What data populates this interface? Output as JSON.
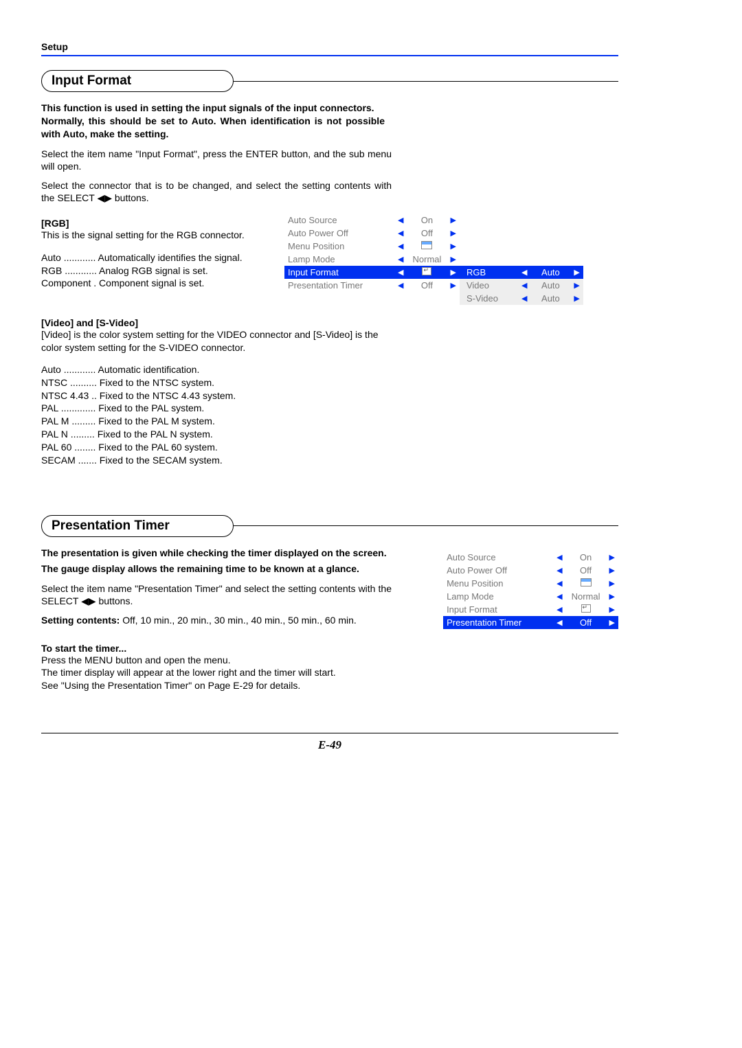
{
  "header": "Setup",
  "s1": {
    "title": "Input Format",
    "intro": "This function is used in setting the input signals of the input connectors.\nNormally, this should be set to Auto. When identification is not possible with Auto, make the setting.",
    "body1": "Select the item name \"Input Format\", press the ENTER button, and the sub menu will open.",
    "body2": "Select the connector that is to be changed, and select the setting contents with the SELECT ◀▶ buttons.",
    "rgb": {
      "head": "[RGB]",
      "desc": "This is the signal setting for the RGB connector.",
      "items": [
        {
          "k": "Auto",
          "dots": "............",
          "v": "Automatically identifies the signal."
        },
        {
          "k": "RGB",
          "dots": "............",
          "v": "Analog RGB signal is set."
        },
        {
          "k": "Component",
          "dots": " .",
          "v": "Component signal is set."
        }
      ]
    },
    "video": {
      "head": "[Video] and [S-Video]",
      "desc": "[Video] is the color system setting for the VIDEO connector and [S-Video] is the color system setting for the S-VIDEO connector.",
      "items": [
        {
          "k": "Auto",
          "dots": "............",
          "v": "Automatic identification."
        },
        {
          "k": "NTSC",
          "dots": "..........",
          "v": "Fixed to the NTSC system."
        },
        {
          "k": "NTSC 4.43",
          "dots": " ..",
          "v": "Fixed to the NTSC 4.43 system."
        },
        {
          "k": "PAL",
          "dots": ".............",
          "v": "Fixed to the PAL system."
        },
        {
          "k": "PAL M",
          "dots": ".........",
          "v": "Fixed to the PAL M system."
        },
        {
          "k": "PAL N",
          "dots": ".........",
          "v": "Fixed to the PAL N system."
        },
        {
          "k": "PAL 60",
          "dots": "........",
          "v": "Fixed to the PAL 60 system."
        },
        {
          "k": "SECAM",
          "dots": ".......",
          "v": "Fixed to the SECAM system."
        }
      ]
    },
    "osd": {
      "rows": [
        {
          "label": "Auto Source",
          "val": "On",
          "hl": false,
          "icon": false
        },
        {
          "label": "Auto Power Off",
          "val": "Off",
          "hl": false,
          "icon": false
        },
        {
          "label": "Menu Position",
          "val": "",
          "hl": false,
          "icon": "window"
        },
        {
          "label": "Lamp Mode",
          "val": "Normal",
          "hl": false,
          "icon": false
        },
        {
          "label": "Input Format",
          "val": "",
          "hl": true,
          "icon": "submenu"
        },
        {
          "label": "Presentation Timer",
          "val": "Off",
          "hl": false,
          "icon": false
        }
      ],
      "sub": [
        {
          "label": "RGB",
          "val": "Auto",
          "hl": true
        },
        {
          "label": "Video",
          "val": "Auto",
          "hl": false
        },
        {
          "label": "S-Video",
          "val": "Auto",
          "hl": false
        }
      ]
    }
  },
  "s2": {
    "title": "Presentation Timer",
    "intro1": "The presentation is given while checking the timer displayed on the screen.",
    "intro2": "The gauge display allows the remaining time to be known at a glance.",
    "body": "Select the item name \"Presentation Timer\" and select the setting contents with the SELECT ◀▶ buttons.",
    "settings_label": "Setting contents:",
    "settings_val": " Off, 10 min., 20 min., 30 min., 40 min., 50 min., 60 min.",
    "start": {
      "head": "To start the timer...",
      "l1": "Press the MENU button and open the menu.",
      "l2": "The timer display will appear at the lower right and the timer will start.",
      "l3": "See \"Using the Presentation Timer\" on Page E-29 for details."
    },
    "osd": {
      "rows": [
        {
          "label": "Auto Source",
          "val": "On",
          "hl": false,
          "icon": false
        },
        {
          "label": "Auto Power Off",
          "val": "Off",
          "hl": false,
          "icon": false
        },
        {
          "label": "Menu Position",
          "val": "",
          "hl": false,
          "icon": "window"
        },
        {
          "label": "Lamp Mode",
          "val": "Normal",
          "hl": false,
          "icon": false
        },
        {
          "label": "Input Format",
          "val": "",
          "hl": false,
          "icon": "submenu"
        },
        {
          "label": "Presentation Timer",
          "val": "Off",
          "hl": true,
          "icon": false
        }
      ]
    }
  },
  "pagenum": "E-49"
}
